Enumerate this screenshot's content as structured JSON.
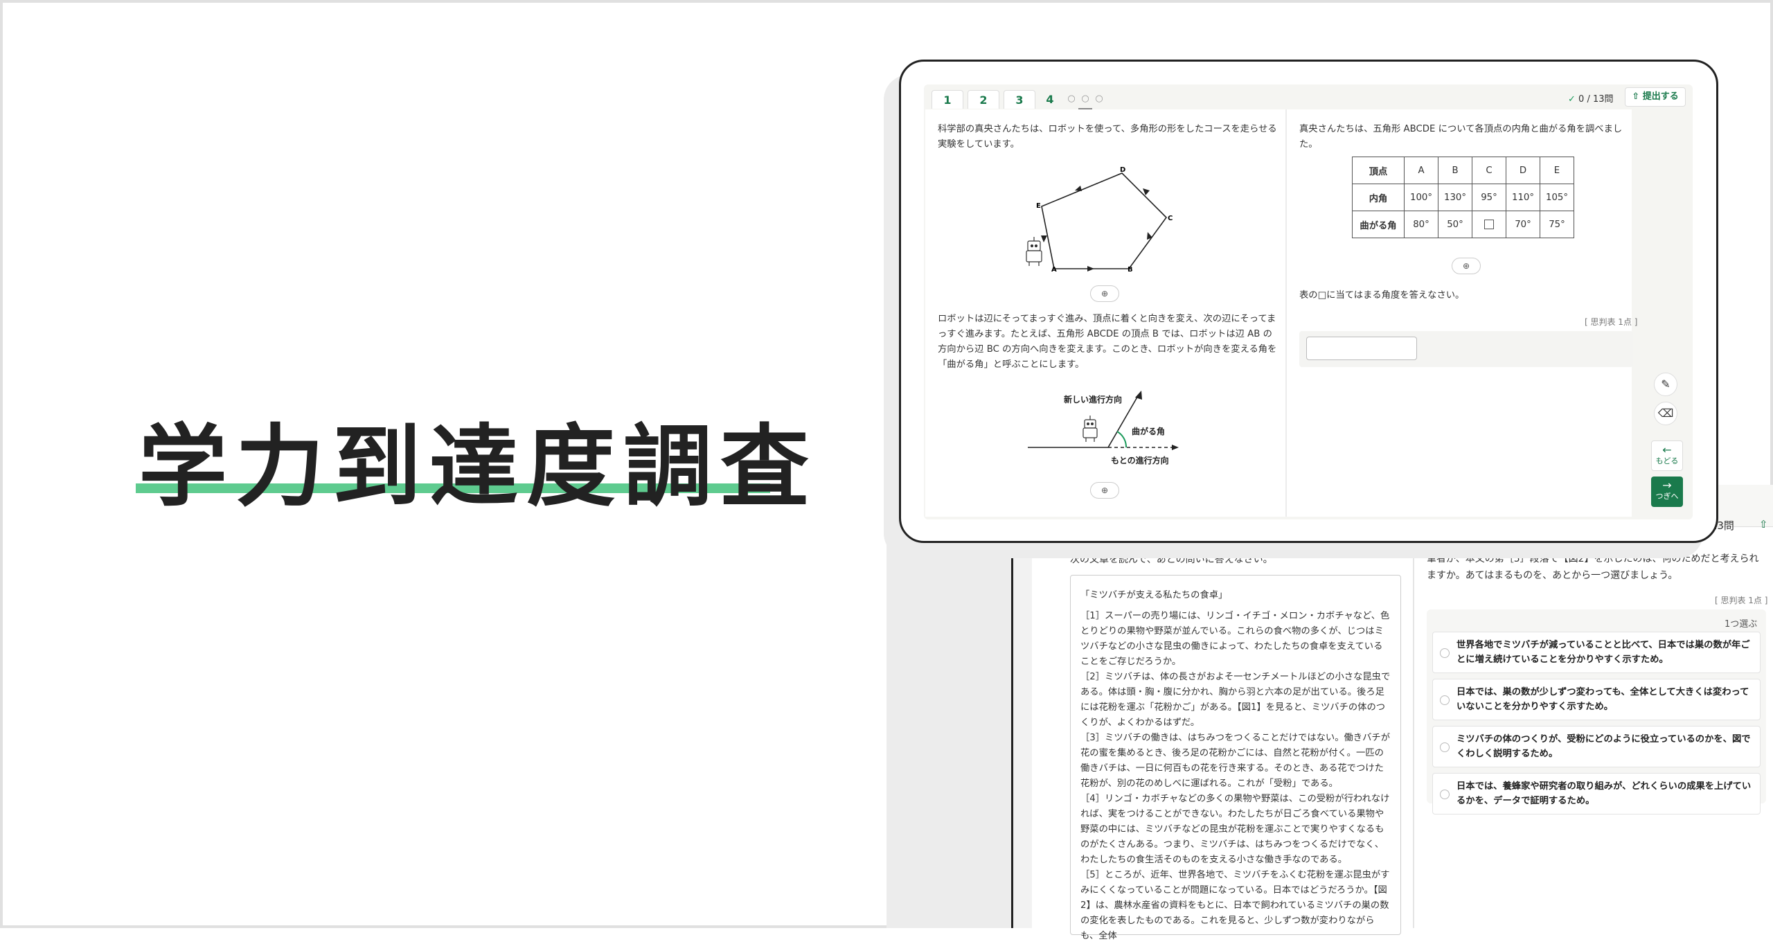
{
  "hero": {
    "title": "学力到達度調査"
  },
  "front": {
    "tabs": [
      "1",
      "2",
      "3",
      "4"
    ],
    "dot_tabs": [
      "○",
      "○",
      "○"
    ],
    "counter": "0 / 13問",
    "counter_check": "✓",
    "submit_label": "提出する",
    "submit_icon": "⇧",
    "left_intro": "科学部の真央さんたちは、ロボットを使って、多角形の形をしたコースを走らせる実験をしています。",
    "left_body": "ロボットは辺にそってまっすぐ進み、頂点に着くと向きを変え、次の辺にそってまっすぐ進みます。たとえば、五角形 ABCDE の頂点 B では、ロボットは辺 AB の方向から辺 BC の方向へ向きを変えます。このとき、ロボットが向きを変える角を「曲がる角」と呼ぶことにします。",
    "pentagon_labels": {
      "A": "A",
      "B": "B",
      "C": "C",
      "D": "D",
      "E": "E"
    },
    "turn_fig_labels": {
      "new_dir": "新しい進行方向",
      "turn_angle": "曲がる角",
      "orig_dir": "もとの進行方向"
    },
    "right_intro": "真央さんたちは、五角形 ABCDE について各頂点の内角と曲がる角を調べました。",
    "table": {
      "header": [
        "頂点",
        "A",
        "B",
        "C",
        "D",
        "E"
      ],
      "inner_label": "内角",
      "inner": [
        "100°",
        "130°",
        "95°",
        "110°",
        "105°"
      ],
      "turn_label": "曲がる角",
      "turn": [
        "80°",
        "50°",
        "",
        "70°",
        "75°"
      ]
    },
    "right_question": "表の□に当てはまる角度を答えなさい。",
    "score_label": "[ 思判表 1点 ]",
    "zoom_icon": "⊕",
    "pencil_icon": "✎",
    "eraser_icon": "⌫",
    "back_label": "もどる",
    "back_arrow": "←",
    "next_label": "つぎへ",
    "next_arrow": "→"
  },
  "back": {
    "counter": "/ 13問",
    "submit_icon": "⇧",
    "intro": "次の文章を読んで、あとの問いに答えなさい。",
    "passage_title": "「ミツバチが支える私たちの食卓」",
    "paragraphs": [
      "［1］スーパーの売り場には、リンゴ・イチゴ・メロン・カボチャなど、色とりどりの果物や野菜が並んでいる。これらの食べ物の多くが、じつはミツバチなどの小さな昆虫の働きによって、わたしたちの食卓を支えていることをご存じだろうか。",
      "［2］ミツバチは、体の長さがおよそ一センチメートルほどの小さな昆虫である。体は頭・胸・腹に分かれ、胸から羽と六本の足が出ている。後ろ足には花粉を運ぶ「花粉かご」がある。【図1】を見ると、ミツバチの体のつくりが、よくわかるはずだ。",
      "［3］ミツバチの働きは、はちみつをつくることだけではない。働きバチが花の蜜を集めるとき、後ろ足の花粉かごには、自然と花粉が付く。一匹の働きバチは、一日に何百もの花を行き来する。そのとき、ある花でつけた花粉が、別の花のめしべに運ばれる。これが「受粉」である。",
      "［4］リンゴ・カボチャなどの多くの果物や野菜は、この受粉が行われなければ、実をつけることができない。わたしたちが日ごろ食べている果物や野菜の中には、ミツバチなどの昆虫が花粉を運ぶことで実りやすくなるものがたくさんある。つまり、ミツバチは、はちみつをつくるだけでなく、わたしたちの食生活そのものを支える小さな働き手なのである。",
      "［5］ところが、近年、世界各地で、ミツバチをふくむ花粉を運ぶ昆虫がすみにくくなっていることが問題になっている。日本ではどうだろうか。【図2】は、農林水産省の資料をもとに、日本で飼われているミツバチの巣の数の変化を表したものである。これを見ると、少しずつ数が変わりながらも、全体"
    ],
    "question": "筆者が、本文の第［5］段落で【図2】を示したのは、何のためだと考えられますか。あてはまるものを、あとから一つ選びましょう。",
    "score_label": "[ 思判表 1点 ]",
    "choose_label": "1つ選ぶ",
    "choices": [
      "世界各地でミツバチが減っていることと比べて、日本では巣の数が年ごとに増え続けていることを分かりやすく示すため。",
      "日本では、巣の数が少しずつ変わっても、全体として大きくは変わっていないことを分かりやすく示すため。",
      "ミツバチの体のつくりが、受粉にどのように役立っているのかを、図でくわしく説明するため。",
      "日本では、養蜂家や研究者の取り組みが、どれくらいの成果を上げているかを、データで証明するため。"
    ]
  }
}
